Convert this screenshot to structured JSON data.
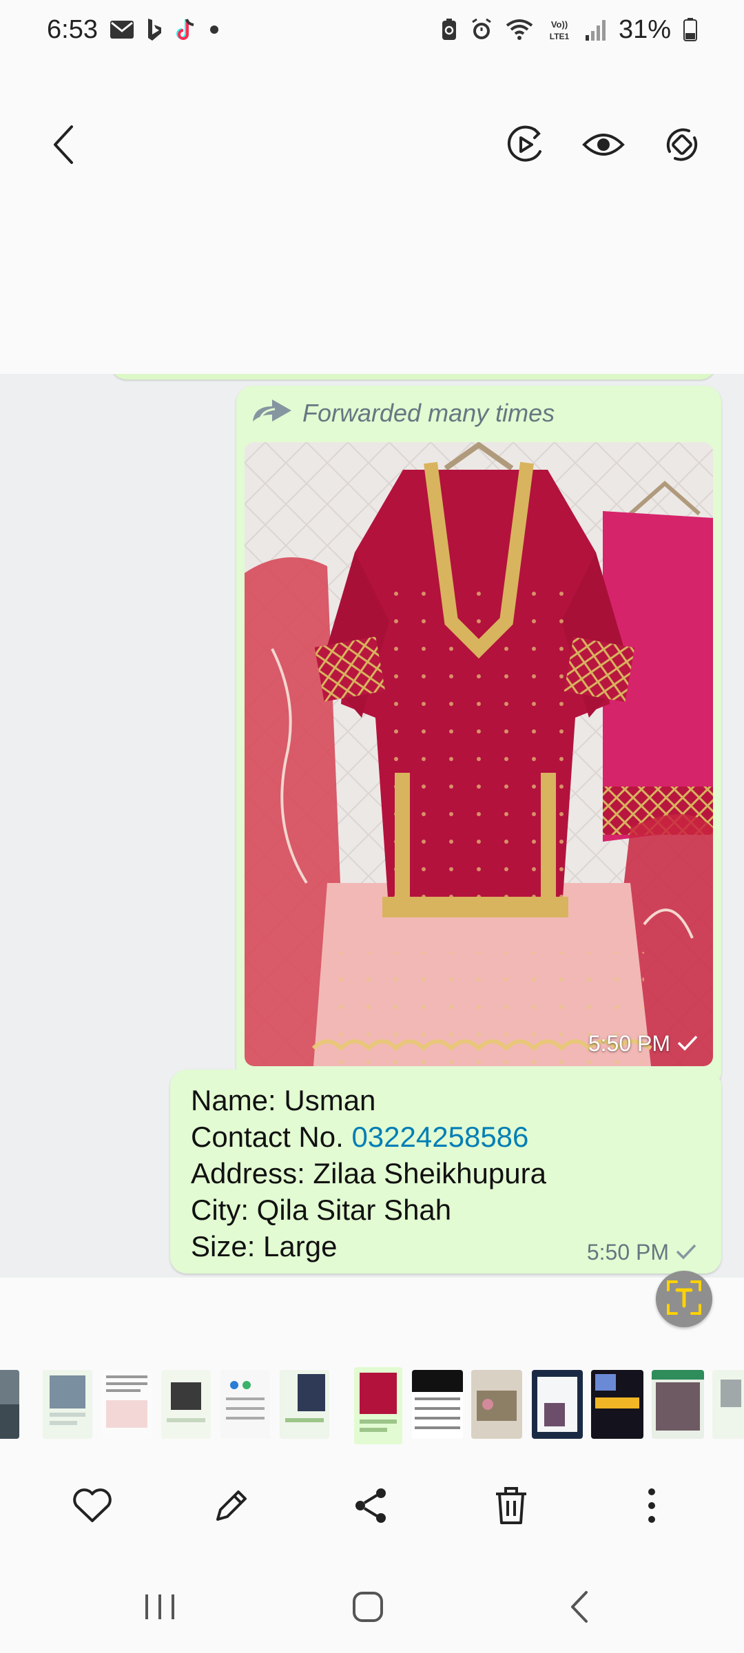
{
  "status_bar": {
    "time": "6:53",
    "battery": "31%",
    "left_icons": [
      "mail-icon",
      "bing-icon",
      "tiktok-icon",
      "dot-icon"
    ],
    "right_icons": [
      "battery-saver-icon",
      "alarm-icon",
      "wifi-icon",
      "volte-icon",
      "signal-icon",
      "battery-icon"
    ]
  },
  "top_bar": {
    "icons": [
      "back-icon",
      "motion-photo-icon",
      "view-once-icon",
      "rotate-icon"
    ]
  },
  "chat": {
    "image_message": {
      "forwarded_label": "Forwarded many times",
      "time": "5:50 PM"
    },
    "text_message": {
      "lines": {
        "name": "Name: Usman",
        "contact_prefix": "Contact No. ",
        "contact_number": "03224258586",
        "address": "Address: Zilaa Sheikhupura",
        "city": "City: Qila Sitar Shah",
        "size": "Size: Large"
      },
      "time": "5:50 PM"
    },
    "colors": {
      "bubble": "#e2fbd2",
      "chat_background": "#edeff0",
      "link": "#027eb5",
      "timestamp": "#667781"
    }
  },
  "actions": {
    "icons": [
      "heart-icon",
      "edit-icon",
      "share-icon",
      "delete-icon",
      "more-icon"
    ]
  },
  "nav_bar": {
    "icons": [
      "recent-apps-icon",
      "home-icon",
      "back-nav-icon"
    ]
  }
}
